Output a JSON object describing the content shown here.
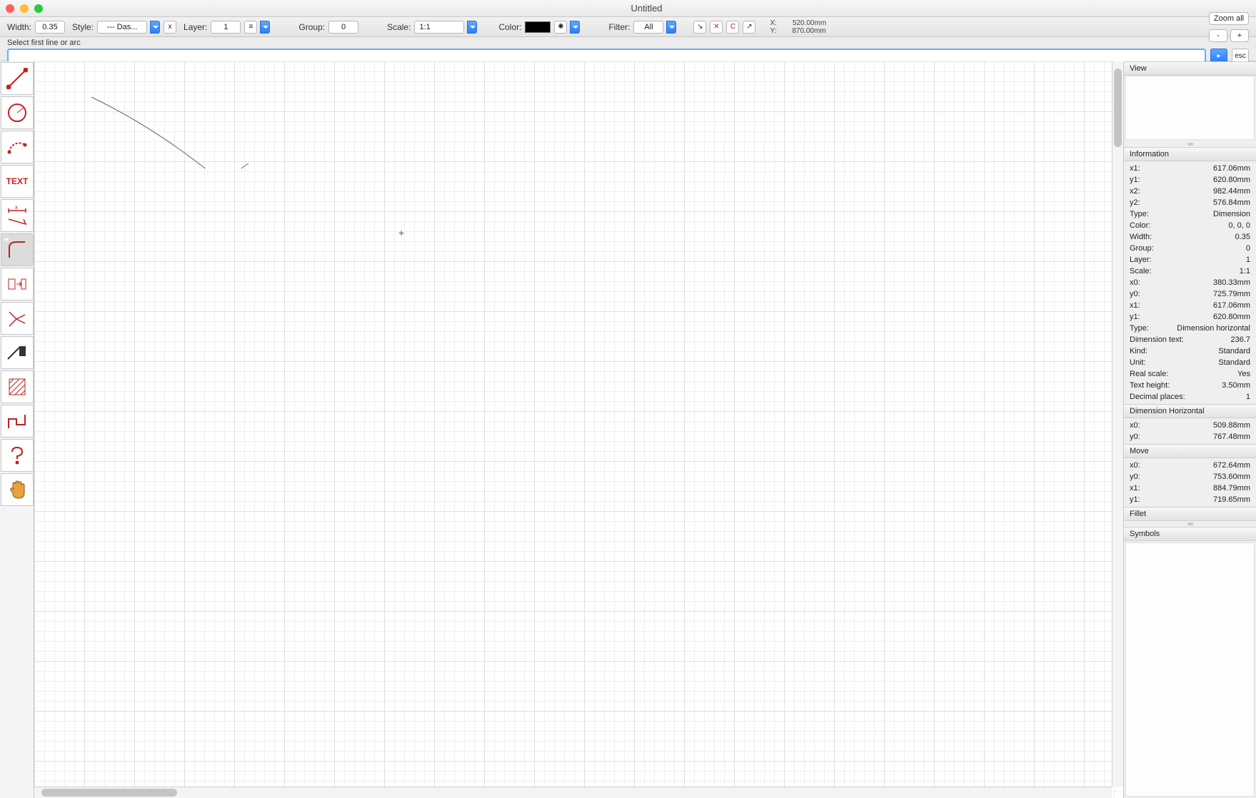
{
  "window": {
    "title": "Untitled"
  },
  "toolbar": {
    "width_label": "Width:",
    "width_value": "0.35",
    "style_label": "Style:",
    "style_value": "--- Das...",
    "x_btn": "x",
    "layer_label": "Layer:",
    "layer_value": "1",
    "group_label": "Group:",
    "group_value": "0",
    "scale_label": "Scale:",
    "scale_value": "1:1",
    "color_label": "Color:",
    "filter_label": "Filter:",
    "filter_value": "All",
    "coord_x_label": "X:",
    "coord_x": "520.00mm",
    "coord_y_label": "Y:",
    "coord_y": "870.00mm",
    "zoom_all": "Zoom all",
    "zoom_minus": "-",
    "zoom_plus": "+",
    "esc": "esc"
  },
  "prompt": "Select first line or arc",
  "tools": [
    "line",
    "circle",
    "arc",
    "text",
    "dimension",
    "fillet",
    "mirror",
    "trim",
    "delete",
    "hatch",
    "polyline",
    "help",
    "pan"
  ],
  "inspector": {
    "view_title": "View",
    "info_title": "Information",
    "info": {
      "x1": "617.06mm",
      "y1": "620.80mm",
      "x2": "982.44mm",
      "y2": "576.84mm",
      "Type": "Dimension",
      "Color": "0, 0, 0",
      "Width": "0.35",
      "Group": "0",
      "Layer": "1",
      "Scale": "1:1",
      "x0": "380.33mm",
      "y0": "725.79mm",
      "x1b": "617.06mm",
      "y1b": "620.80mm",
      "Type2": "Dimension horizontal",
      "Dimension_text": "236.7",
      "Kind": "Standard",
      "Unit": "Standard",
      "Real_scale": "Yes",
      "Text_height": "3.50mm",
      "Decimal_places": "1"
    },
    "dimh_title": "Dimension Horizontal",
    "dimh": {
      "x0": "509.88mm",
      "y0": "767.48mm"
    },
    "move_title": "Move",
    "move": {
      "x0": "672.64mm",
      "y0": "753.60mm",
      "x1": "884.79mm",
      "y1": "719.65mm"
    },
    "fillet_title": "Fillet",
    "symbols_title": "Symbols"
  }
}
